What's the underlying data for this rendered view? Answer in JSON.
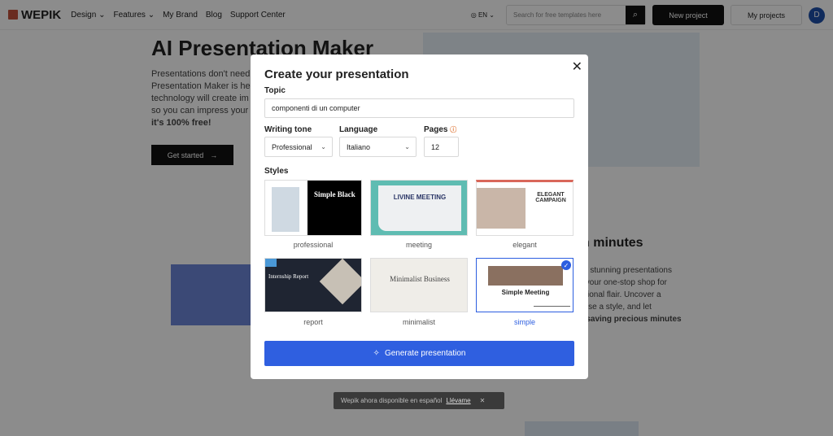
{
  "nav": {
    "logo": "WEPIK",
    "items": [
      "Design ⌄",
      "Features ⌄",
      "My Brand",
      "Blog",
      "Support Center"
    ],
    "lang": "◎ EN ⌄",
    "search_placeholder": "Search for free templates here",
    "new_project": "New project",
    "my_projects": "My projects",
    "avatar": "D"
  },
  "hero": {
    "title": "AI Presentation Maker",
    "lines": [
      "Presentations don't need",
      "Presentation Maker is her",
      "technology will create im",
      "so you can impress your a",
      "it's 100% free!"
    ],
    "cta": "Get started"
  },
  "section": {
    "title": "n minutes",
    "lines": [
      "ke stunning presentations",
      "s your one-stop shop for",
      "ssional flair. Uncover a",
      "oose a style, and let",
      "e saving precious minutes"
    ]
  },
  "modal": {
    "title": "Create your presentation",
    "topic_label": "Topic",
    "topic_value": "componenti di un computer",
    "tone_label": "Writing tone",
    "tone_value": "Professional",
    "language_label": "Language",
    "language_value": "Italiano",
    "pages_label": "Pages",
    "pages_value": "12",
    "styles_label": "Styles",
    "styles": [
      {
        "name": "professional",
        "preview": "Simple Black",
        "selected": false
      },
      {
        "name": "meeting",
        "preview": "LIVINE MEETING",
        "selected": false
      },
      {
        "name": "elegant",
        "preview": "ELEGANT CAMPAIGN",
        "selected": false
      },
      {
        "name": "report",
        "preview": "Internship Report",
        "selected": false
      },
      {
        "name": "minimalist",
        "preview": "Minimalist Business",
        "selected": false
      },
      {
        "name": "simple",
        "preview": "Simple Meeting",
        "selected": true
      }
    ],
    "generate": "Generate presentation"
  },
  "toast": {
    "text": "Wepik ahora disponible en español",
    "link": "Llévame"
  },
  "colors": {
    "accent": "#2f5fe0",
    "logo": "#c2513b"
  }
}
